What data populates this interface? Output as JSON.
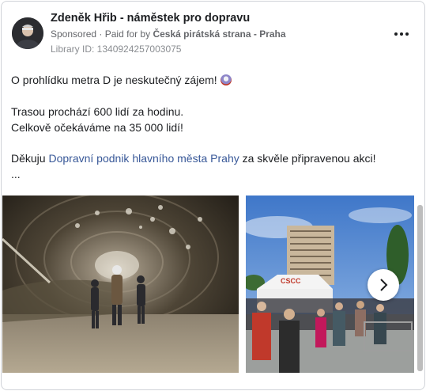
{
  "post": {
    "page_name": "Zdeněk Hřib - náměstek pro dopravu",
    "sponsored_label": "Sponsored",
    "paid_for_prefix": "Paid for by",
    "funder": "Česká pirátská strana - Praha",
    "library_id": "Library ID: 1340924257003075",
    "more_icon": "more-horizontal-icon",
    "lines": {
      "line1": "O prohlídku metra D je neskutečný zájem!",
      "line2": "Trasou prochází 600 lidí za hodinu.",
      "line3": "Celkově očekáváme na 35 000 lidí!",
      "line4_prefix": "Děkuju",
      "line4_link": "Dopravní podnik hlavního města Prahy",
      "line4_suffix": "za skvěle připravenou akci!",
      "ellipsis": "..."
    },
    "emoji": "metro-emoji"
  },
  "carousel": {
    "photos": [
      "tunnel-walk-photo",
      "crowd-event-photo"
    ],
    "next_icon": "chevron-right-icon",
    "tent_sign": "CSCC"
  },
  "colors": {
    "link": "#385898",
    "text": "#1c1e21",
    "secondary": "#65676b"
  }
}
